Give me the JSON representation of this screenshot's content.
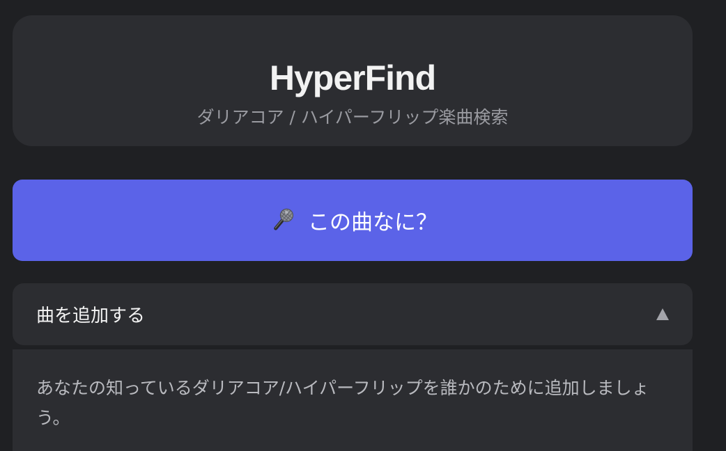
{
  "header": {
    "title": "HyperFind",
    "subtitle": "ダリアコア / ハイパーフリップ楽曲検索"
  },
  "identify_button": {
    "icon": "microphone-icon",
    "label": "この曲なに？"
  },
  "add_song_section": {
    "title": "曲を追加する",
    "expanded": true,
    "toggle_icon": "triangle-up-icon",
    "description": "あなたの知っているダリアコア/ハイパーフリップを誰かのために追加しましょう。"
  },
  "colors": {
    "background": "#1f2023",
    "card": "#2c2d31",
    "accent": "#5b63e8",
    "muted_text": "#9a9ba1"
  }
}
